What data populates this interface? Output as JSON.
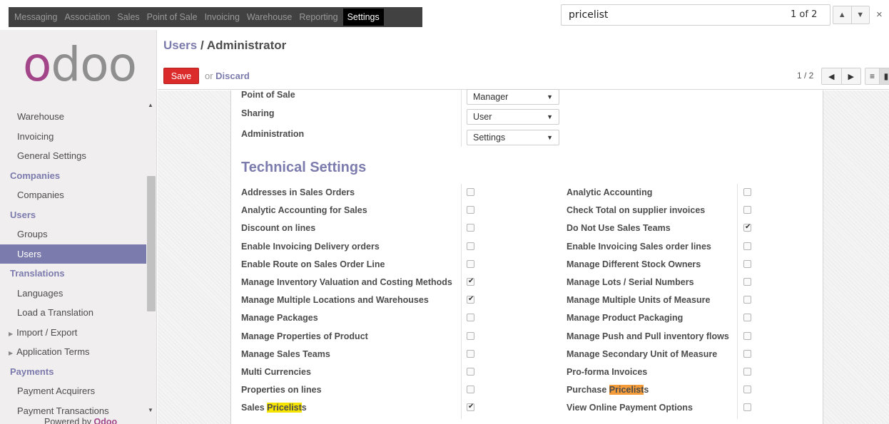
{
  "menubar": {
    "items": [
      "Messaging",
      "Association",
      "Sales",
      "Point of Sale",
      "Invoicing",
      "Warehouse",
      "Reporting",
      "Settings"
    ],
    "active": "Settings"
  },
  "find": {
    "query": "pricelist",
    "count": "1 of 2"
  },
  "sidebar": {
    "logo_first": "o",
    "logo_rest": "doo",
    "items": [
      {
        "type": "item",
        "label": "Warehouse"
      },
      {
        "type": "item",
        "label": "Invoicing"
      },
      {
        "type": "item",
        "label": "General Settings"
      },
      {
        "type": "header",
        "label": "Companies"
      },
      {
        "type": "item",
        "label": "Companies"
      },
      {
        "type": "header",
        "label": "Users"
      },
      {
        "type": "item",
        "label": "Groups"
      },
      {
        "type": "item",
        "label": "Users",
        "active": true
      },
      {
        "type": "header",
        "label": "Translations"
      },
      {
        "type": "item",
        "label": "Languages"
      },
      {
        "type": "item",
        "label": "Load a Translation"
      },
      {
        "type": "expand",
        "label": "Import / Export"
      },
      {
        "type": "expand",
        "label": "Application Terms"
      },
      {
        "type": "header",
        "label": "Payments"
      },
      {
        "type": "item",
        "label": "Payment Acquirers"
      },
      {
        "type": "item",
        "label": "Payment Transactions"
      }
    ],
    "powered_prefix": "Powered by ",
    "powered_brand": "Odoo"
  },
  "header": {
    "breadcrumb_link": "Users",
    "breadcrumb_sep": " / ",
    "breadcrumb_current": "Administrator",
    "save_label": "Save",
    "or_label": "or ",
    "discard_label": "Discard",
    "pager": "1 / 2"
  },
  "access_rights": [
    {
      "label": "Point of Sale",
      "value": "Manager"
    },
    {
      "label": "Sharing",
      "value": "User"
    },
    {
      "label": "Administration",
      "value": "Settings"
    }
  ],
  "technical": {
    "title": "Technical Settings",
    "left": [
      {
        "label": "Addresses in Sales Orders",
        "checked": false
      },
      {
        "label": "Analytic Accounting for Sales",
        "checked": false
      },
      {
        "label": "Discount on lines",
        "checked": false
      },
      {
        "label": "Enable Invoicing Delivery orders",
        "checked": false
      },
      {
        "label": "Enable Route on Sales Order Line",
        "checked": false
      },
      {
        "label": "Manage Inventory Valuation and Costing Methods",
        "checked": true
      },
      {
        "label": "Manage Multiple Locations and Warehouses",
        "checked": true
      },
      {
        "label": "Manage Packages",
        "checked": false
      },
      {
        "label": "Manage Properties of Product",
        "checked": false
      },
      {
        "label": "Manage Sales Teams",
        "checked": false
      },
      {
        "label": "Multi Currencies",
        "checked": false
      },
      {
        "label": "Properties on lines",
        "checked": false
      },
      {
        "label": "Sales ",
        "highlight": "Pricelist",
        "suffix": "s",
        "hl": "yellow",
        "checked": true
      }
    ],
    "right": [
      {
        "label": "Analytic Accounting",
        "checked": false
      },
      {
        "label": "Check Total on supplier invoices",
        "checked": false
      },
      {
        "label": "Do Not Use Sales Teams",
        "checked": true
      },
      {
        "label": "Enable Invoicing Sales order lines",
        "checked": false
      },
      {
        "label": "Manage Different Stock Owners",
        "checked": false
      },
      {
        "label": "Manage Lots / Serial Numbers",
        "checked": false
      },
      {
        "label": "Manage Multiple Units of Measure",
        "checked": false
      },
      {
        "label": "Manage Product Packaging",
        "checked": false
      },
      {
        "label": "Manage Push and Pull inventory flows",
        "checked": false
      },
      {
        "label": "Manage Secondary Unit of Measure",
        "checked": false
      },
      {
        "label": "Pro-forma Invoices",
        "checked": false
      },
      {
        "label": "Purchase ",
        "highlight": "Pricelist",
        "suffix": "s",
        "hl": "orange",
        "checked": false
      },
      {
        "label": "View Online Payment Options",
        "checked": false
      }
    ]
  },
  "colors": {
    "accent": "#7c7bad",
    "brand": "#a24689",
    "save": "#dc2b2b",
    "menubar": "#414141"
  }
}
